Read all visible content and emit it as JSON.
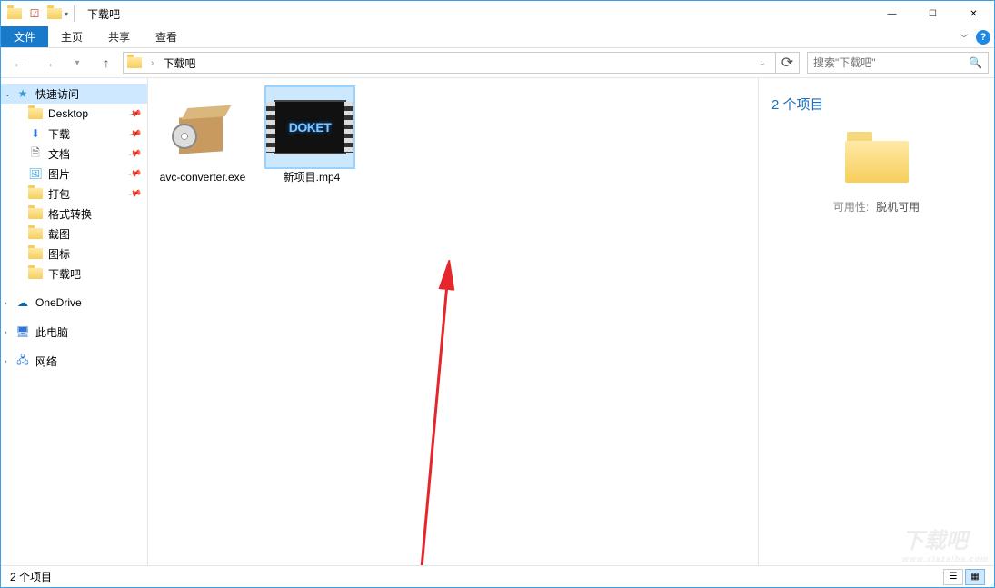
{
  "window": {
    "title": "下载吧",
    "min": "—",
    "max": "☐",
    "close": "✕"
  },
  "ribbon": {
    "file": "文件",
    "tabs": [
      "主页",
      "共享",
      "查看"
    ],
    "help": "?"
  },
  "addressbar": {
    "path_folder": "下载吧",
    "search_placeholder": "搜索\"下载吧\""
  },
  "sidebar": {
    "quick_access": "快速访问",
    "items": [
      {
        "label": "Desktop",
        "icon": "folder",
        "pinned": true
      },
      {
        "label": "下载",
        "icon": "download",
        "pinned": true
      },
      {
        "label": "文档",
        "icon": "document",
        "pinned": true
      },
      {
        "label": "图片",
        "icon": "picture",
        "pinned": true
      },
      {
        "label": "打包",
        "icon": "folder",
        "pinned": true
      },
      {
        "label": "格式转换",
        "icon": "folder",
        "pinned": false
      },
      {
        "label": "截图",
        "icon": "folder",
        "pinned": false
      },
      {
        "label": "图标",
        "icon": "folder",
        "pinned": false
      },
      {
        "label": "下载吧",
        "icon": "folder",
        "pinned": false
      }
    ],
    "onedrive": "OneDrive",
    "this_pc": "此电脑",
    "network": "网络"
  },
  "files": [
    {
      "name": "avc-converter.exe",
      "type": "exe",
      "selected": false
    },
    {
      "name": "新项目.mp4",
      "type": "video",
      "selected": true,
      "thumb_text": "DOKET"
    }
  ],
  "details": {
    "title": "2 个项目",
    "availability_label": "可用性:",
    "availability_value": "脱机可用"
  },
  "statusbar": {
    "count": "2 个项目"
  },
  "watermark": {
    "big": "下载吧",
    "small": "www.xiazaiba.com"
  }
}
